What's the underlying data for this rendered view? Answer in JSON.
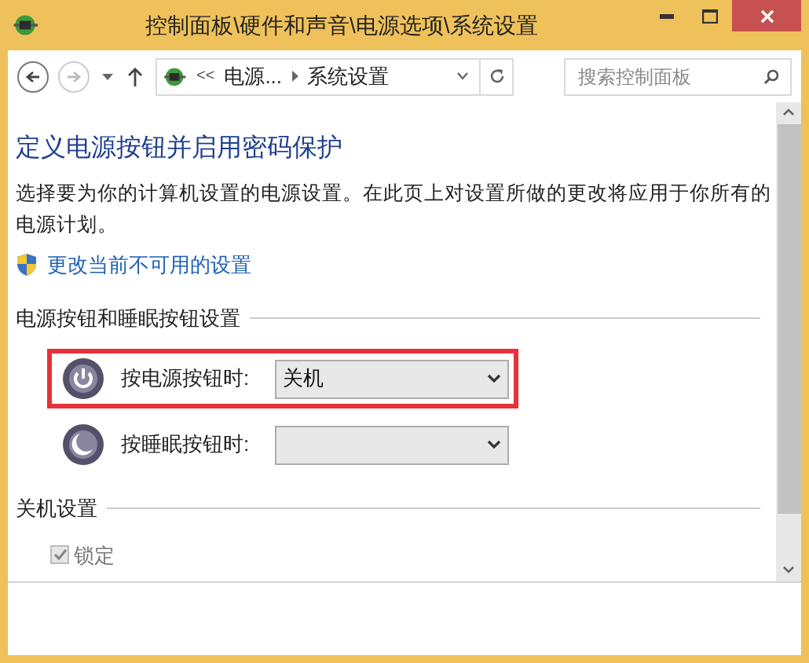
{
  "window": {
    "title": "控制面板\\硬件和声音\\电源选项\\系统设置"
  },
  "address_bar": {
    "overflow": "<<",
    "crumbs": [
      "电源...",
      "系统设置"
    ]
  },
  "search": {
    "placeholder": "搜索控制面板"
  },
  "page": {
    "heading": "定义电源按钮并启用密码保护",
    "description": "选择要为你的计算机设置的电源设置。在此页上对设置所做的更改将应用于你所有的电源计划。",
    "admin_link": "更改当前不可用的设置"
  },
  "button_section": {
    "title": "电源按钮和睡眠按钮设置",
    "rows": [
      {
        "kind": "power",
        "label": "按电源按钮时:",
        "value": "关机",
        "highlighted": true
      },
      {
        "kind": "sleep",
        "label": "按睡眠按钮时:",
        "value": "",
        "highlighted": false
      }
    ]
  },
  "shutdown_section": {
    "title": "关机设置",
    "options": [
      {
        "label": "锁定",
        "checked": true,
        "disabled": true
      }
    ]
  }
}
